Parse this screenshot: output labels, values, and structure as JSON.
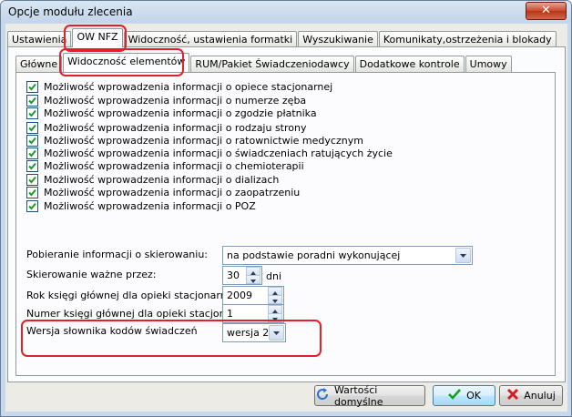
{
  "window": {
    "title": "Opcje modułu zlecenia",
    "close": "✕"
  },
  "tabs_top": [
    {
      "label": "Ustawienia"
    },
    {
      "label": "OW NFZ"
    },
    {
      "label": "Widoczność, ustawienia formatki"
    },
    {
      "label": "Wyszukiwanie"
    },
    {
      "label": "Komunikaty,ostrzeżenia i blokady"
    }
  ],
  "tabs_sub": [
    {
      "label": "Główne"
    },
    {
      "label": "Widoczność elementów"
    },
    {
      "label": "RUM/Pakiet Świadczeniodawcy"
    },
    {
      "label": "Dodatkowe kontrole"
    },
    {
      "label": "Umowy"
    }
  ],
  "checkboxes": [
    {
      "label": "Możliwość wprowadzenia informacji o opiece stacjonarnej",
      "checked": true
    },
    {
      "label": "Możliwość wprowadzenia informacji o numerze zęba",
      "checked": true
    },
    {
      "label": "Możliwość wprowadzenia informacji o zgodzie płatnika",
      "checked": true
    },
    {
      "label": "Możliwość wprowadzenia informacji o rodzaju strony",
      "checked": true
    },
    {
      "label": "Możliwość wprowadzenia informacji o ratownictwie medycznym",
      "checked": true
    },
    {
      "label": "Możliwość wprowadzenia informacji o świadczeniach ratujących życie",
      "checked": true
    },
    {
      "label": "Możliwość wprowadzenia informacji o chemioterapii",
      "checked": true
    },
    {
      "label": "Możliwość wprowadzenia informacji o dializach",
      "checked": true
    },
    {
      "label": "Możliwość wprowadzenia informacji o zaopatrzeniu",
      "checked": true
    },
    {
      "label": "Możliwość wprowadzenia informacji o POZ",
      "checked": true
    }
  ],
  "fields": {
    "referral_label": "Pobieranie informacji o skierowaniu:",
    "referral_value": "na podstawie poradni wykonującej",
    "valid_label": "Skierowanie ważne przez:",
    "valid_value": "30",
    "valid_unit": "dni",
    "year_label": "Rok księgi głównej dla opieki stacjonarnej:",
    "year_value": "2009",
    "number_label": "Numer księgi głównej dla opieki stacjonarnej:",
    "number_value": "1",
    "dict_label": "Wersja słownika kodów świadczeń",
    "dict_value": "wersja 2"
  },
  "buttons": {
    "defaults": "Wartości domyślne",
    "ok": "OK",
    "cancel": "Anuluj"
  },
  "colors": {
    "highlight": "#e0202a",
    "check": "#1a9c22"
  }
}
